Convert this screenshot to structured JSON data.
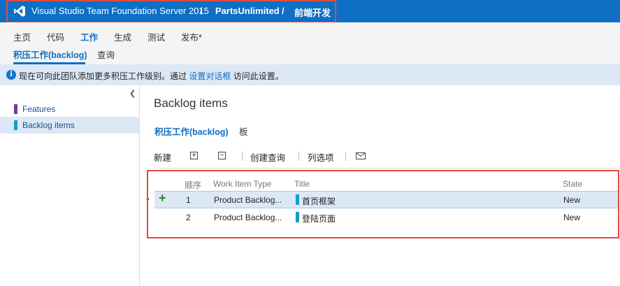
{
  "header": {
    "app_title": "Visual Studio Team Foundation Server 2015",
    "separator": "/",
    "project": "PartsUnlimited",
    "team": "前端开发"
  },
  "nav": {
    "items": [
      {
        "label": "主页"
      },
      {
        "label": "代码"
      },
      {
        "label": "工作"
      },
      {
        "label": "生成"
      },
      {
        "label": "测试"
      },
      {
        "label": "发布*"
      }
    ],
    "active": "工作",
    "subitems": [
      {
        "label": "积压工作(backlog)"
      },
      {
        "label": "查询"
      }
    ]
  },
  "info": {
    "text_before": "现在可向此团队添加更多积压工作级别。通过 ",
    "link": "设置对话框",
    "text_after": " 访问此设置。"
  },
  "left_panel": {
    "collapse_icon": "chevron-left-icon",
    "items": [
      {
        "label": "Features",
        "color": "#773b93"
      },
      {
        "label": "Backlog items",
        "color": "#1a9cc9",
        "selected": true
      }
    ]
  },
  "content": {
    "title": "Backlog items",
    "pivots": [
      {
        "label": "积压工作(backlog)"
      },
      {
        "label": "板"
      }
    ],
    "toolbar": {
      "new_label": "新建",
      "expand_icon": "expand-icon",
      "collapse_icon": "collapse-icon",
      "create_query_label": "创建查询",
      "column_options_label": "列选项",
      "email_icon": "mail-icon"
    },
    "grid": {
      "columns": [
        "顺序",
        "Work Item Type",
        "Title",
        "State"
      ],
      "rows": [
        {
          "order": "1",
          "type": "Product Backlog...",
          "title": "首页框架",
          "state": "New"
        },
        {
          "order": "2",
          "type": "Product Backlog...",
          "title": "登陆页面",
          "state": "New"
        }
      ]
    }
  },
  "colors": {
    "header_bg": "#0e6fc5",
    "accent": "#0e6fc5",
    "highlight_outline": "#e04b3f",
    "info_bg": "#dce8f6",
    "add_icon": "#2b8a2b"
  }
}
